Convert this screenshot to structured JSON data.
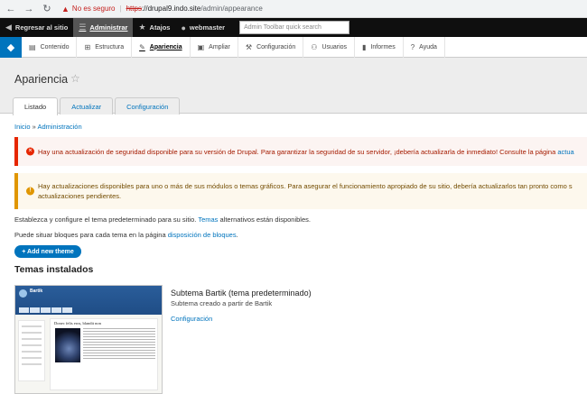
{
  "browser": {
    "security_label": "No es seguro",
    "url_protocol": "https",
    "url_host": "://drupal9.indo.site",
    "url_path": "/admin/appearance"
  },
  "toolbar": {
    "back_to_site": "Regresar al sitio",
    "manage": "Administrar",
    "shortcuts": "Atajos",
    "user": "webmaster",
    "search_placeholder": "Admin Toolbar quick search"
  },
  "tray": {
    "items": [
      "Contenido",
      "Estructura",
      "Apariencia",
      "Ampliar",
      "Configuración",
      "Usuarios",
      "Informes",
      "Ayuda"
    ]
  },
  "page": {
    "title": "Apariencia",
    "tabs": [
      "Listado",
      "Actualizar",
      "Configuración"
    ]
  },
  "breadcrumb": {
    "home": "Inicio",
    "separator": "»",
    "admin": "Administración"
  },
  "messages": {
    "error_text": "Hay una actualización de seguridad disponible para su versión de Drupal. Para garantizar la seguridad de su servidor, ¡debería actualizarla de inmediato! Consulte la página",
    "error_link": "actua",
    "warning_text": "Hay actualizaciones disponibles para uno o más de sus módulos o temas gráficos. Para asegurar el funcionamiento apropiado de su sitio, debería actualizarlos tan pronto como s",
    "warning_text2": "actualizaciones pendientes."
  },
  "content": {
    "p1_before": "Establezca y configure el tema predeterminado para su sitio.",
    "p1_link": "Temas",
    "p1_after": "alternativos están disponibles.",
    "p2_before": "Puede situar bloques para cada tema en la página",
    "p2_link": "disposición de bloques",
    "p2_after": ".",
    "add_button": "+ Add new theme",
    "installed_title": "Temas instalados"
  },
  "theme": {
    "name": "Subtema Bartik (tema predeterminado)",
    "description": "Subtema creado a partir de Bartik",
    "settings_link": "Configuración",
    "thumb_sitename": "Bartik",
    "thumb_article_title": "Donec felis eros, blandit non"
  },
  "colors": {
    "drupal_blue": "#0074bd",
    "error_red": "#e62600",
    "warning_orange": "#e09600"
  }
}
